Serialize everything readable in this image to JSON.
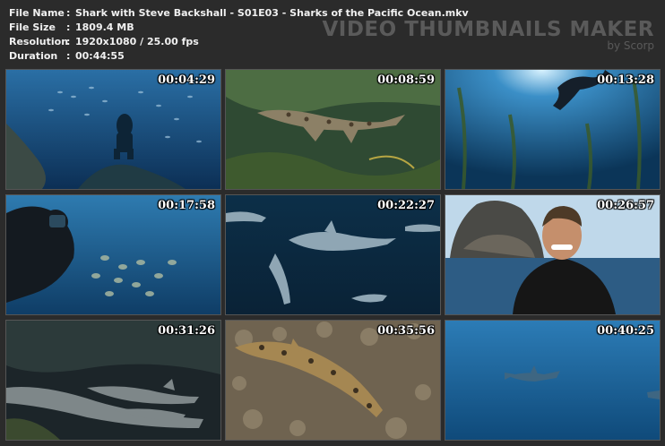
{
  "info": {
    "file_name": {
      "label": "File Name",
      "value": "Shark with Steve Backshall - S01E03 - Sharks of the Pacific Ocean.mkv"
    },
    "file_size": {
      "label": "File Size",
      "value": "1809.4 MB"
    },
    "resolution": {
      "label": "Resolution",
      "value": "1920x1080 / 25.00 fps"
    },
    "duration": {
      "label": "Duration",
      "value": "00:44:55"
    },
    "separator": ":"
  },
  "brand": {
    "title": "VIDEO THUMBNAILS MAKER",
    "byline": "by Scorp"
  },
  "thumbnails": [
    {
      "timestamp": "00:04:29"
    },
    {
      "timestamp": "00:08:59"
    },
    {
      "timestamp": "00:13:28"
    },
    {
      "timestamp": "00:17:58"
    },
    {
      "timestamp": "00:22:27"
    },
    {
      "timestamp": "00:26:57"
    },
    {
      "timestamp": "00:31:26"
    },
    {
      "timestamp": "00:35:56"
    },
    {
      "timestamp": "00:40:25"
    }
  ]
}
